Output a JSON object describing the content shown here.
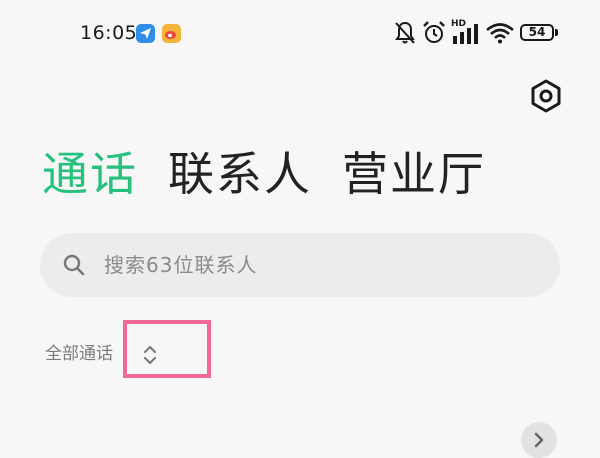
{
  "status_bar": {
    "time": "16:05",
    "network_label": "HD",
    "battery_level": "54",
    "icons": [
      "location-app-icon",
      "weibo-app-icon",
      "mute-icon",
      "alarm-icon",
      "signal-icon",
      "wifi-icon",
      "battery-icon"
    ]
  },
  "header": {
    "settings_icon": "settings-hexagon-icon"
  },
  "tabs": [
    {
      "label": "通话",
      "active": true
    },
    {
      "label": "联系人",
      "active": false
    },
    {
      "label": "营业厅",
      "active": false
    }
  ],
  "search": {
    "placeholder": "搜索63位联系人"
  },
  "filter": {
    "label": "全部通话"
  },
  "colors": {
    "accent": "#27c07c",
    "highlight": "#f06b94",
    "background": "#f7f7f7",
    "search_bg": "#ececec"
  }
}
